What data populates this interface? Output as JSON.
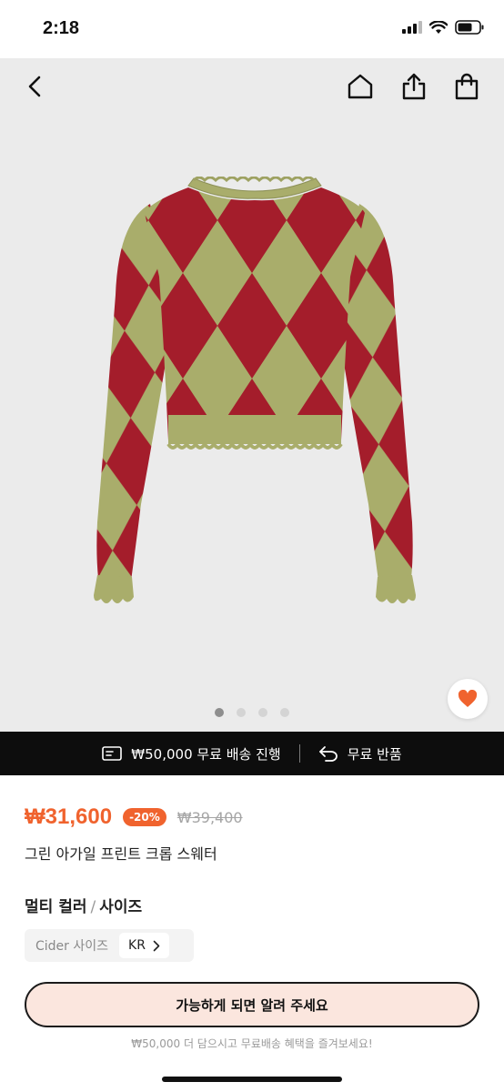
{
  "status_bar": {
    "time": "2:18"
  },
  "nav": {
    "icons": [
      "chevron-left-icon",
      "home-icon",
      "share-icon",
      "shopping-bag-icon"
    ]
  },
  "gallery": {
    "image_count": 4,
    "active_index": 0,
    "wishlist_color": "#f0632e"
  },
  "promo": {
    "shipping_text": "₩50,000 무료 배송 진행",
    "return_text": "무료 반품"
  },
  "product": {
    "price": "₩31,600",
    "discount": "-20%",
    "original_price": "₩39,400",
    "title": "그린 아가일 프린트 크롭 스웨터"
  },
  "options": {
    "color_label": "멀티 컬러",
    "separator": "/",
    "size_label": "사이즈",
    "size_system_label": "Cider 사이즈",
    "size_system_value": "KR"
  },
  "cta": {
    "notify_label": "가능하게 되면 알려 주세요",
    "footnote": "₩50,000 더 담으시고 무료배송 혜택을 즐겨보세요!"
  },
  "colors": {
    "accent": "#f0632e",
    "sweater_green": "#a9ad6b",
    "sweater_red": "#a41d2b"
  }
}
